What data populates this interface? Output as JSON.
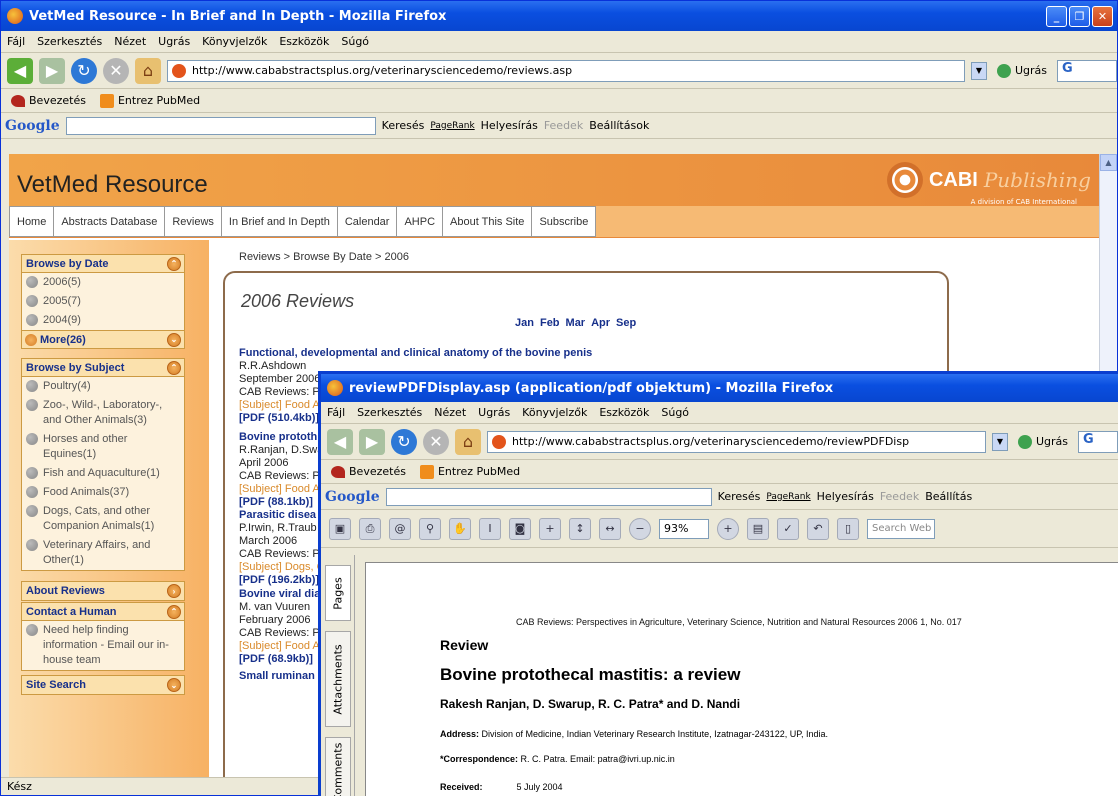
{
  "window1": {
    "title": "VetMed Resource - In Brief and In Depth - Mozilla Firefox",
    "menu": [
      "Fájl",
      "Szerkesztés",
      "Nézet",
      "Ugrás",
      "Könyvjelzők",
      "Eszközök",
      "Súgó"
    ],
    "url": "http://www.cababstractsplus.org/veterinarysciencedemo/reviews.asp",
    "go_label": "Ugrás",
    "google_box": "G",
    "bookmarks": [
      "Bevezetés",
      "Entrez PubMed"
    ],
    "googlebar": {
      "logo": "Google",
      "search": "Keresés",
      "pagerank": "PageRank",
      "spell": "Helyesírás",
      "feeds": "Feedek",
      "settings": "Beállítások"
    },
    "status": "Kész"
  },
  "site": {
    "title": "VetMed Resource",
    "logo_text": "CABI",
    "logo_pub": "Publishing",
    "logo_sub": "A division of CAB International",
    "nav": [
      "Home",
      "Abstracts Database",
      "Reviews",
      "In Brief and In Depth",
      "Calendar",
      "AHPC",
      "About This Site",
      "Subscribe"
    ],
    "breadcrumb": "Reviews > Browse By Date > 2006",
    "sidebar": {
      "browse_date": "Browse by Date",
      "dates": [
        "2006(5)",
        "2005(7)",
        "2004(9)"
      ],
      "more": "More(26)",
      "browse_subject": "Browse by Subject",
      "subjects": [
        "Poultry(4)",
        "Zoo-, Wild-, Laboratory-, and Other Animals(3)",
        "Horses and other Equines(1)",
        "Fish and Aquaculture(1)",
        "Food Animals(37)",
        "Dogs, Cats, and other Companion Animals(1)",
        "Veterinary Affairs, and Other(1)"
      ],
      "about": "About Reviews",
      "contact": "Contact a Human",
      "contact_text": "Need help finding information - Email our in-house team",
      "search": "Site Search"
    },
    "content": {
      "title": "2006 Reviews",
      "months": [
        "Jan",
        "Feb",
        "Mar",
        "Apr",
        "Sep"
      ],
      "reviews": [
        {
          "title": "Functional, developmental and clinical anatomy of the bovine penis",
          "author": "R.R.Ashdown",
          "date": "September 2006",
          "journal": "CAB Reviews: P",
          "subject": "[Subject] Food A",
          "pdf": "[PDF (510.4kb)]"
        },
        {
          "title": "Bovine prototh",
          "author": "R.Ranjan, D.Swa",
          "date": "April 2006",
          "journal": "CAB Reviews: P",
          "subject": "[Subject] Food A",
          "pdf": "[PDF (88.1kb)]"
        },
        {
          "title": "Parasitic disea",
          "author": "P.Irwin, R.Traub",
          "date": "March 2006",
          "journal": "CAB Reviews: P",
          "subject": "[Subject] Dogs, C",
          "pdf": "[PDF (196.2kb)]"
        },
        {
          "title": "Bovine viral dia",
          "author": "M. van Vuuren",
          "date": "February 2006",
          "journal": "CAB Reviews: P",
          "subject": "[Subject] Food A",
          "pdf": "[PDF (68.9kb)]"
        },
        {
          "title": "Small ruminan",
          "author": "",
          "date": "",
          "journal": "",
          "subject": "",
          "pdf": ""
        }
      ]
    }
  },
  "window2": {
    "title": "reviewPDFDisplay.asp (application/pdf objektum) - Mozilla Firefox",
    "menu": [
      "Fájl",
      "Szerkesztés",
      "Nézet",
      "Ugrás",
      "Könyvjelzők",
      "Eszközök",
      "Súgó"
    ],
    "url": "http://www.cababstractsplus.org/veterinarysciencedemo/reviewPDFDisp",
    "go_label": "Ugrás",
    "bookmarks": [
      "Bevezetés",
      "Entrez PubMed"
    ],
    "googlebar": {
      "logo": "Google",
      "search": "Keresés",
      "pagerank": "PageRank",
      "spell": "Helyesírás",
      "feeds": "Feedek",
      "settings": "Beállítás"
    },
    "zoom": "93%",
    "search_web": "Search Web",
    "side_tabs": [
      "Pages",
      "Attachments",
      "Comments"
    ],
    "pdf": {
      "header": "CAB Reviews: Perspectives in Agriculture, Veterinary Science, Nutrition and Natural Resources 2006 1, No. 017",
      "section": "Review",
      "title": "Bovine protothecal mastitis: a review",
      "authors": "Rakesh Ranjan, D. Swarup, R. C. Patra* and D. Nandi",
      "address_label": "Address:",
      "address": "Division of Medicine, Indian Veterinary Research Institute, Izatnagar-243122, UP, India.",
      "corr_label": "*Correspondence:",
      "corr": "R. C. Patra. Email: patra@ivri.up.nic.in",
      "received_label": "Received:",
      "received": "5 July 2004"
    }
  }
}
